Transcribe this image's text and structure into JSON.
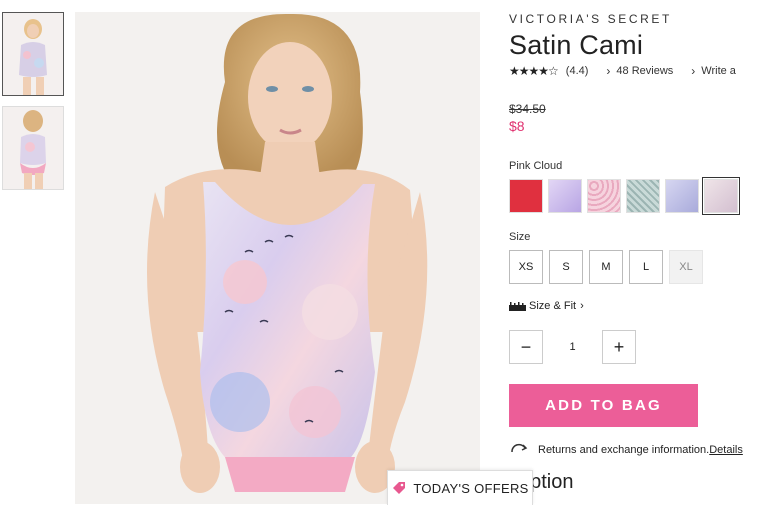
{
  "product": {
    "brand": "VICTORIA'S SECRET",
    "title": "Satin Cami",
    "stars": "★★★★☆",
    "rating": "(4.4)",
    "reviews": "48 Reviews",
    "write": "Write a",
    "old_price": "$34.50",
    "new_price": "$8"
  },
  "color": {
    "label": "Pink Cloud",
    "swatches": [
      {
        "name": "red-heart-print",
        "color": "#e0303f"
      },
      {
        "name": "lilac-satin",
        "color": "#c9b7ea"
      },
      {
        "name": "pink-heart-print",
        "color": "#f2c2d2"
      },
      {
        "name": "teal-pattern",
        "color": "#b5cbc8"
      },
      {
        "name": "lavender-birds",
        "color": "#bdbde3"
      },
      {
        "name": "pink-cloud",
        "color": "#e8d5da"
      }
    ]
  },
  "size": {
    "label": "Size",
    "options": [
      "XS",
      "S",
      "M",
      "L",
      "XL"
    ],
    "fit_label": "Size & Fit"
  },
  "quantity": {
    "minus": "−",
    "value": "1",
    "plus": "+"
  },
  "actions": {
    "add_to_bag": "ADD TO BAG"
  },
  "returns": {
    "text": "Returns and exchange information.",
    "details": "Details"
  },
  "description": {
    "heading": "cription"
  },
  "offers": {
    "label": "TODAY'S OFFERS"
  },
  "colors": {
    "accent": "#ec5e98",
    "sale": "#e0316f"
  }
}
